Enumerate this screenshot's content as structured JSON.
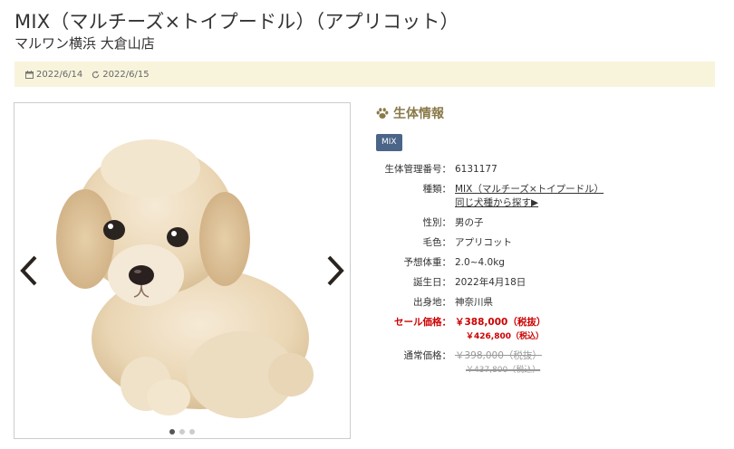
{
  "header": {
    "title": "MIX（マルチーズ×トイプードル）（アプリコット）",
    "subtitle": "マルワン横浜 大倉山店"
  },
  "dates": {
    "posted": "2022/6/14",
    "updated": "2022/6/15",
    "posted_icon": "calendar-icon",
    "updated_icon": "refresh-icon"
  },
  "gallery": {
    "image_alt": "puppy-photo",
    "slide_count": 3,
    "active_slide": 1,
    "prev_icon": "chevron-left-icon",
    "next_icon": "chevron-right-icon"
  },
  "info": {
    "heading": "生体情報",
    "heading_icon": "paw-icon",
    "badge": "MIX",
    "badge_color": "#4a6588",
    "rows": [
      {
        "label": "生体管理番号：",
        "value": "6131177"
      },
      {
        "label": "種類：",
        "value": "MIX（マルチーズ×トイプードル）",
        "link2": "同じ犬種から探す▶"
      },
      {
        "label": "性別：",
        "value": "男の子"
      },
      {
        "label": "毛色：",
        "value": "アプリコット"
      },
      {
        "label": "予想体重：",
        "value": "2.0~4.0kg"
      },
      {
        "label": "誕生日：",
        "value": "2022年4月18日"
      },
      {
        "label": "出身地：",
        "value": "神奈川県"
      }
    ],
    "sale": {
      "label": "セール価格：",
      "price": "￥388,000（税抜）",
      "price_tax": "￥426,800（税込）",
      "color": "#cc0000"
    },
    "regular": {
      "label": "通常価格：",
      "price": "￥398,000（税抜）",
      "price_tax": "￥437,800（税込）"
    }
  },
  "colors": {
    "accent": "#8a7a4a",
    "datebar_bg": "#f8f4dc"
  }
}
